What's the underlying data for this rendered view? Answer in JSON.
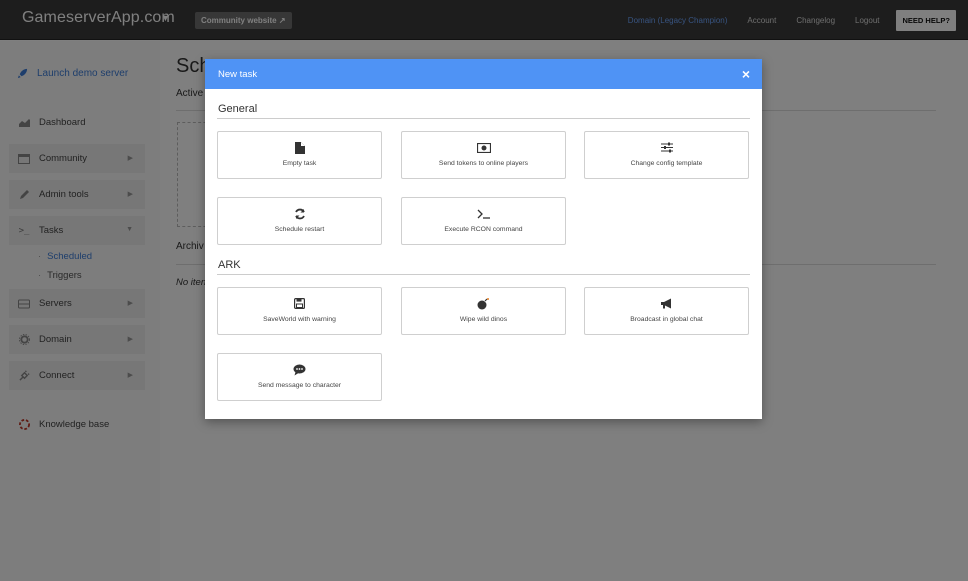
{
  "topbar": {
    "brand": "GameserverApp.com",
    "community_button": "Community website",
    "nav": {
      "domain": "Domain (Legacy Champion)",
      "account": "Account",
      "changelog": "Changelog",
      "logout": "Logout",
      "help": "NEED HELP?"
    }
  },
  "sidebar": {
    "launch": "Launch demo server",
    "items": {
      "dashboard": "Dashboard",
      "community": "Community",
      "admin_tools": "Admin tools",
      "tasks": "Tasks",
      "scheduled": "Scheduled",
      "triggers": "Triggers",
      "servers": "Servers",
      "domain": "Domain",
      "connect": "Connect",
      "knowledge_base": "Knowledge base"
    }
  },
  "main": {
    "title": "Sch",
    "active_label": "Active",
    "archive_label": "Archiv",
    "no_items": "No iten"
  },
  "modal": {
    "title": "New task",
    "close": "×",
    "sections": {
      "general": "General",
      "ark": "ARK"
    },
    "general_tasks": {
      "empty": "Empty task",
      "tokens": "Send tokens to online players",
      "config": "Change config template",
      "restart": "Schedule restart",
      "rcon": "Execute RCON command"
    },
    "ark_tasks": {
      "saveworld": "SaveWorld with warning",
      "wipe": "Wipe wild dinos",
      "broadcast": "Broadcast in global chat",
      "message": "Send message to character"
    }
  }
}
